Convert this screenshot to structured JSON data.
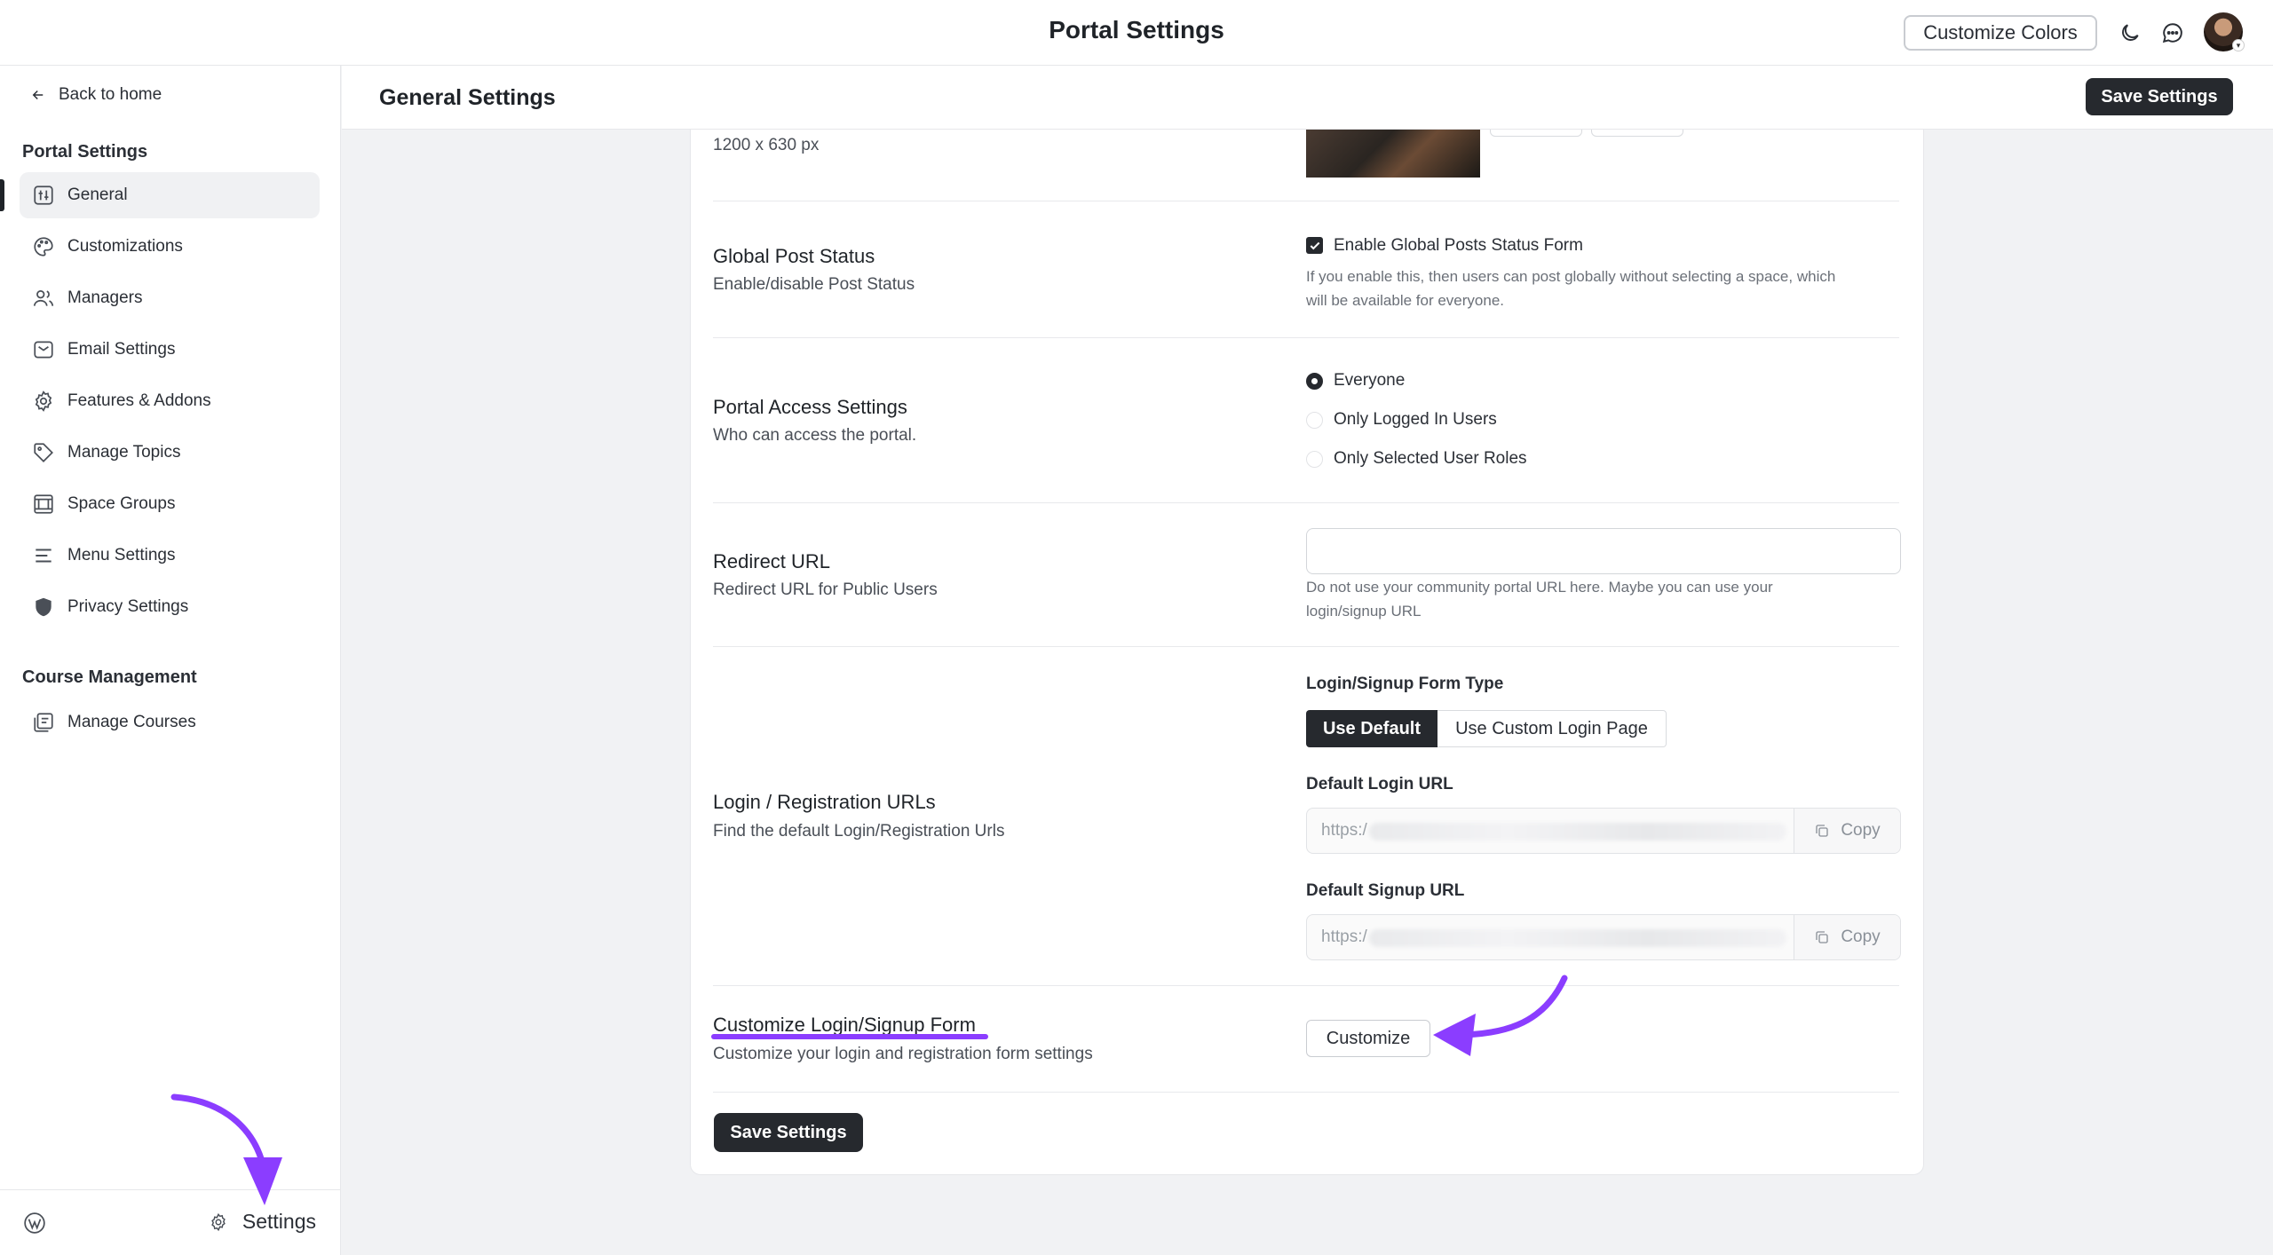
{
  "topbar": {
    "title": "Portal Settings",
    "customize_colors": "Customize Colors"
  },
  "sidebar": {
    "back_label": "Back to home",
    "section1": "Portal Settings",
    "items": [
      {
        "label": "General",
        "icon": "settings-sliders-icon"
      },
      {
        "label": "Customizations",
        "icon": "palette-icon"
      },
      {
        "label": "Managers",
        "icon": "users-icon"
      },
      {
        "label": "Email Settings",
        "icon": "mail-icon"
      },
      {
        "label": "Features & Addons",
        "icon": "gear-icon"
      },
      {
        "label": "Manage Topics",
        "icon": "tag-icon"
      },
      {
        "label": "Space Groups",
        "icon": "grid-icon"
      },
      {
        "label": "Menu Settings",
        "icon": "menu-icon"
      },
      {
        "label": "Privacy Settings",
        "icon": "shield-icon"
      }
    ],
    "section2": "Course Management",
    "course_items": [
      {
        "label": "Manage Courses",
        "icon": "courses-icon"
      }
    ],
    "footer_settings": "Settings"
  },
  "header": {
    "title": "General Settings",
    "save": "Save Settings"
  },
  "main": {
    "image_size": "1200 x 630 px",
    "global_post": {
      "title": "Global Post Status",
      "desc": "Enable/disable Post Status",
      "checkbox_label": "Enable Global Posts Status Form",
      "help_line1": "If you enable this, then users can post globally without selecting a space, which",
      "help_line2": "will be available for everyone."
    },
    "access": {
      "title": "Portal Access Settings",
      "desc": "Who can access the portal.",
      "options": [
        "Everyone",
        "Only Logged In Users",
        "Only Selected User Roles"
      ],
      "selected": "Everyone"
    },
    "redirect": {
      "title": "Redirect URL",
      "desc": "Redirect URL for Public Users",
      "value": "",
      "help_line1": "Do not use your community portal URL here. Maybe you can use your",
      "help_line2": "login/signup URL"
    },
    "login": {
      "title": "Login / Registration URLs",
      "desc": "Find the default Login/Registration Urls",
      "form_type_label": "Login/Signup Form Type",
      "opt_default": "Use Default",
      "opt_custom": "Use Custom Login Page",
      "login_url_label": "Default Login URL",
      "login_url": "https:/",
      "signup_url_label": "Default Signup URL",
      "signup_url": "https:/",
      "copy": "Copy"
    },
    "customize": {
      "title": "Customize Login/Signup Form",
      "desc": "Customize your login and registration form settings",
      "button": "Customize"
    },
    "save": "Save Settings"
  },
  "colors": {
    "annotation": "#8b3dff",
    "dark_button": "#26292e"
  }
}
